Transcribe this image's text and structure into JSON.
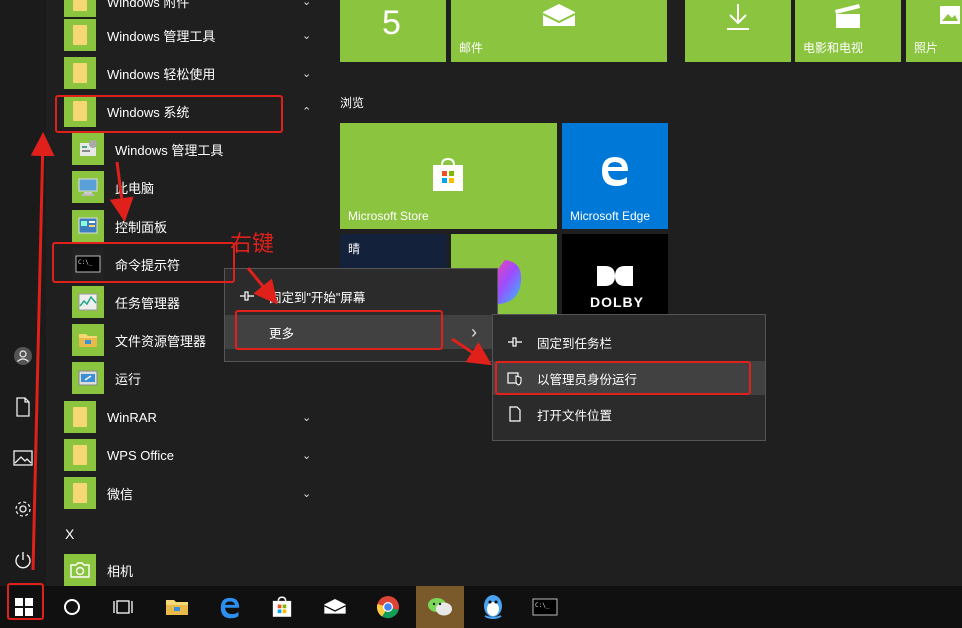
{
  "app_list": {
    "items": [
      {
        "label": "Windows 附件",
        "chevron": "⌄"
      },
      {
        "label": "Windows 管理工具",
        "chevron": "⌄"
      },
      {
        "label": "Windows 轻松使用",
        "chevron": "⌄"
      },
      {
        "label": "Windows 系统",
        "chevron": "⌃"
      },
      {
        "label": "Windows 管理工具"
      },
      {
        "label": "此电脑"
      },
      {
        "label": "控制面板"
      },
      {
        "label": "命令提示符"
      },
      {
        "label": "任务管理器"
      },
      {
        "label": "文件资源管理器"
      },
      {
        "label": "运行"
      },
      {
        "label": "WinRAR",
        "chevron": "⌄"
      },
      {
        "label": "WPS Office",
        "chevron": "⌄"
      },
      {
        "label": "微信",
        "chevron": "⌄"
      },
      {
        "label": "X"
      },
      {
        "label": "相机"
      }
    ]
  },
  "tiles": {
    "group_label": "浏览",
    "calendar_number": "5",
    "mail_label": "邮件",
    "movies_label": "电影和电视",
    "photos_label": "照片",
    "store_label": "Microsoft Store",
    "edge_label": "Microsoft Edge",
    "weather_label": "晴",
    "dolby_label": "DOLBY"
  },
  "context_menu": {
    "pin_start": "固定到\"开始\"屏幕",
    "more": "更多",
    "more_arrow": "›"
  },
  "submenu": {
    "pin_taskbar": "固定到任务栏",
    "run_admin": "以管理员身份运行",
    "open_location": "打开文件位置"
  },
  "annotation": {
    "right_click": "右键"
  },
  "colors": {
    "tile_green": "#8bc53f",
    "edge_blue": "#0078d7",
    "annotation_red": "#e0201a",
    "taskbar": "#101010"
  }
}
